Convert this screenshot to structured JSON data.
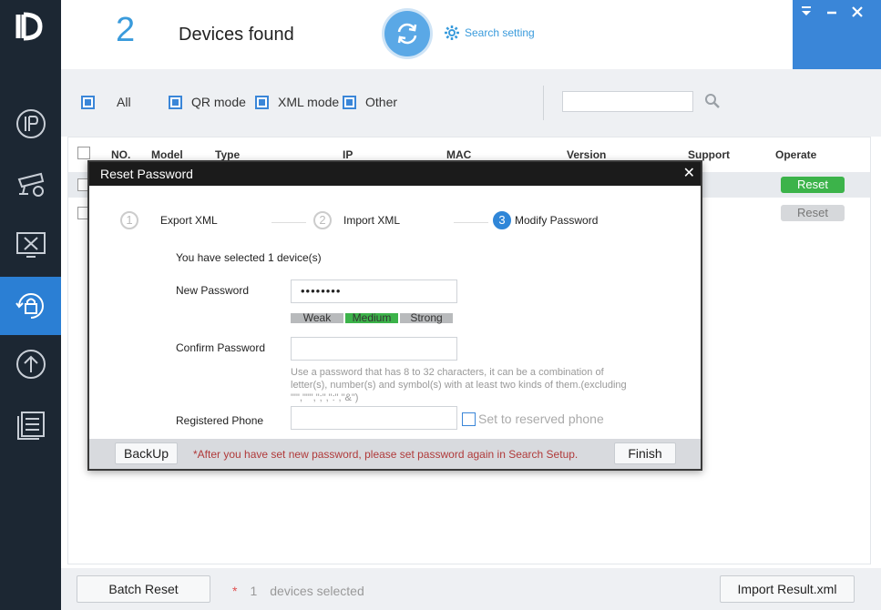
{
  "header": {
    "device_count": "2",
    "devices_found_label": "Devices found",
    "search_setting_label": "Search setting"
  },
  "filters": {
    "all_label": "All",
    "qr_mode_label": "QR mode",
    "xml_mode_label": "XML mode",
    "other_label": "Other",
    "search_value": ""
  },
  "table": {
    "columns": [
      "NO.",
      "Model",
      "Type",
      "IP",
      "MAC",
      "Version",
      "Support",
      "Operate"
    ],
    "rows": [
      {
        "operate_label": "Reset",
        "checked": true
      },
      {
        "operate_label": "Reset",
        "checked": false
      }
    ]
  },
  "modal": {
    "title": "Reset Password",
    "steps": [
      {
        "num": "1",
        "label": "Export XML"
      },
      {
        "num": "2",
        "label": "Import XML"
      },
      {
        "num": "3",
        "label": "Modify Password"
      }
    ],
    "selected_text": "You have selected 1 device(s)",
    "new_password_label": "New Password",
    "new_password_value": "••••••••",
    "strength": [
      "Weak",
      "Medium",
      "Strong"
    ],
    "strength_active": "Medium",
    "confirm_password_label": "Confirm Password",
    "password_hint": "Use a password that has 8 to 32 characters, it can be a combination of letter(s), number(s) and symbol(s) with at least two kinds of them.(excluding \"'\",\"\"\",\";\",\":\",\"&\")",
    "registered_phone_label": "Registered Phone",
    "set_reserved_phone_label": "Set to reserved phone",
    "backup_label": "BackUp",
    "footer_note": "*After you have set new password, please set password again in Search Setup.",
    "finish_label": "Finish"
  },
  "bottom": {
    "batch_reset_label": "Batch Reset",
    "star": "*",
    "selected_count": "1",
    "devices_selected_label": "devices selected",
    "import_result_label": "Import Result.xml"
  },
  "colors": {
    "accent": "#3a86d8",
    "sidebar": "#1c2733",
    "green": "#3cb34a",
    "warning": "#b03a3a"
  }
}
